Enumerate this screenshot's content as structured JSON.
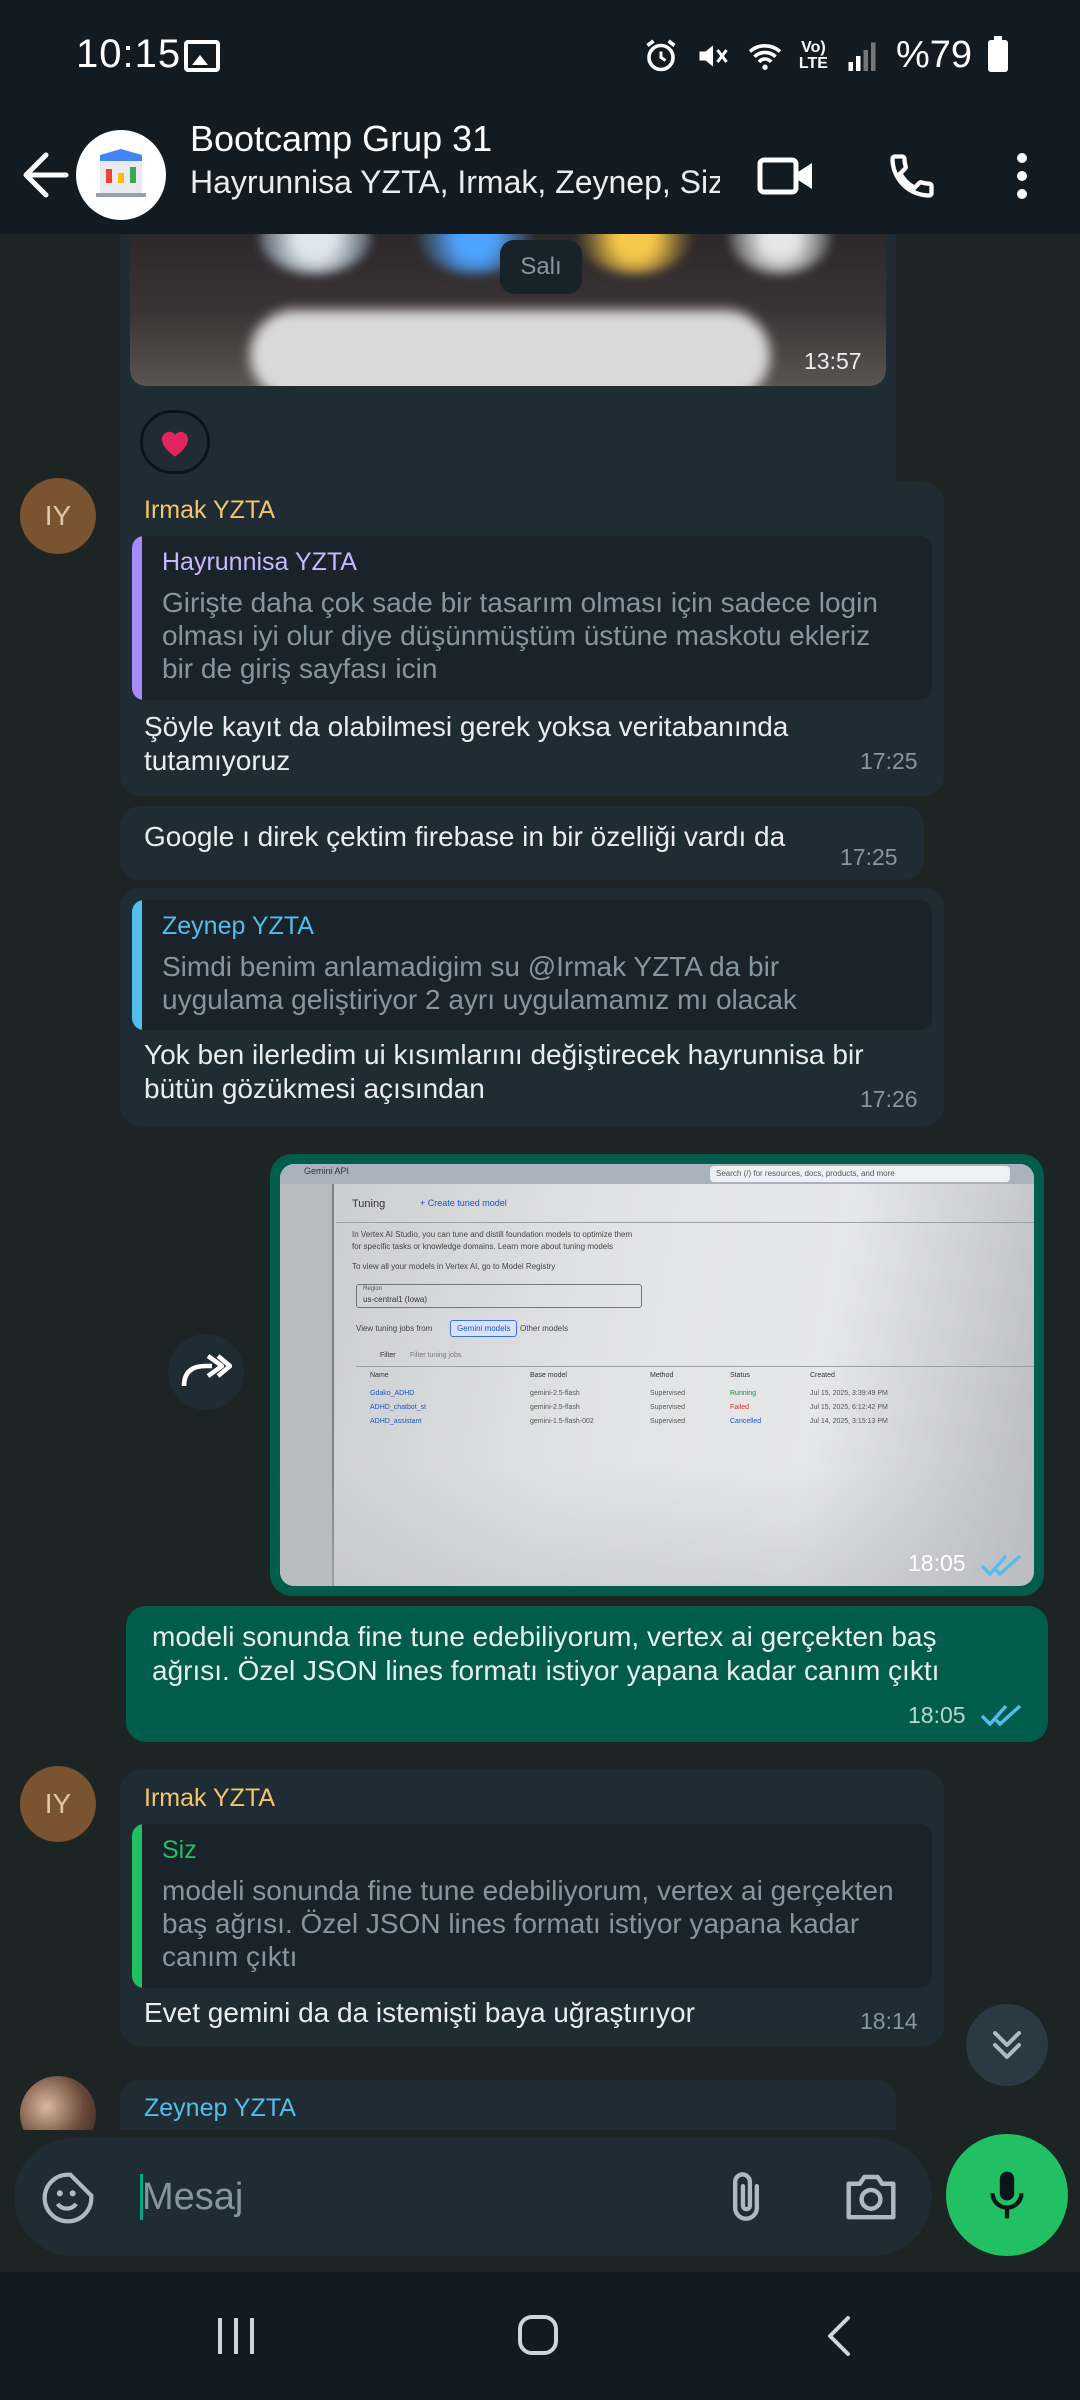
{
  "status_bar": {
    "time": "10:15",
    "battery": "%79",
    "network": "Vo) LTE"
  },
  "header": {
    "title": "Bootcamp Grup 31",
    "subtitle": "Hayrunnisa YZTA, Irmak, Zeynep, Siz"
  },
  "chat": {
    "date_pill": "Salı",
    "image1_time": "13:57",
    "reaction": "❤️",
    "msg1": {
      "avatar": "IY",
      "sender": "Irmak YZTA",
      "quote_name": "Hayrunnisa YZTA",
      "quote_text": "Girişte daha çok sade bir tasarım olması için  sadece  login olması iyi olur diye düşünmüştüm  üstüne maskotu ekleriz bir de giriş sayfası icin",
      "text": "Şöyle kayıt da olabilmesi gerek yoksa veritabanında tutamıyoruz",
      "time": "17:25"
    },
    "msg2": {
      "text": "Google ı direk çektim firebase in bir özelliği vardı da",
      "time": "17:25"
    },
    "msg3": {
      "quote_name": "Zeynep YZTA",
      "quote_text": "Simdi benim anlamadigim su @Irmak YZTA da bir uygulama geliştiriyor 2 ayrı uygulamamız mı olacak",
      "text": "Yok ben ilerledim ui kısımlarını değiştirecek hayrunnisa bir bütün gözükmesi açısından",
      "time": "17:26"
    },
    "screenshot": {
      "time": "18:05",
      "gemini_api": "Gemini API",
      "search_placeholder": "Search (/) for resources, docs, products, and more",
      "tuning": "Tuning",
      "create_tuned": "+ Create tuned model",
      "desc1": "In Vertex AI Studio, you can tune and distill foundation models to optimize them",
      "desc2": "for specific tasks or knowledge domains. Learn more about tuning models",
      "desc3": "To view all your models in Vertex AI, go to Model Registry",
      "region_label": "Region",
      "region_value": "us-central1 (Iowa)",
      "view_jobs": "View tuning jobs from",
      "tab_gemini": "Gemini models",
      "tab_other": "Other models",
      "filter": "Filter",
      "filter_ph": "Filter tuning jobs",
      "columns": [
        "Name",
        "Base model",
        "Method",
        "Status",
        "Created"
      ],
      "rows": [
        [
          "Gdako_ADHD",
          "gemini-2.5-flash",
          "Supervised",
          "Running",
          "Jul 15, 2025, 3:39:49 PM"
        ],
        [
          "ADHD_chatbot_st",
          "gemini-2.5-flash",
          "Supervised",
          "Failed",
          "Jul 15, 2025, 6:12:42 PM"
        ],
        [
          "ADHD_assistant",
          "gemini-1.5-flash-002",
          "Supervised",
          "Cancelled",
          "Jul 14, 2025, 3:15:13 PM"
        ]
      ]
    },
    "msg4": {
      "text": "modeli sonunda fine tune edebiliyorum, vertex ai gerçekten baş ağrısı. Özel JSON lines formatı istiyor yapana kadar canım çıktı",
      "time": "18:05"
    },
    "msg5": {
      "avatar": "IY",
      "sender": "Irmak YZTA",
      "quote_name": "Siz",
      "quote_text": "modeli sonunda fine tune edebiliyorum, vertex ai gerçekten baş ağrısı. Özel JSON lines formatı istiyor yapana kadar canım çıktı",
      "text": "Evet gemini da da istemişti baya uğraştırıyor",
      "time": "18:14"
    },
    "msg6": {
      "sender": "Zeynep YZTA"
    }
  },
  "composer": {
    "placeholder": "Mesaj"
  },
  "colors": {
    "outgoing": "#005c4b",
    "incoming": "#1f2c34",
    "accent": "#21c063",
    "read_ticks": "#53bdeb"
  },
  "icons": [
    "back-arrow-icon",
    "video-call-icon",
    "phone-icon",
    "more-icon",
    "forward-icon",
    "sticker-icon",
    "attach-icon",
    "camera-icon",
    "mic-icon",
    "scroll-down-icon"
  ]
}
